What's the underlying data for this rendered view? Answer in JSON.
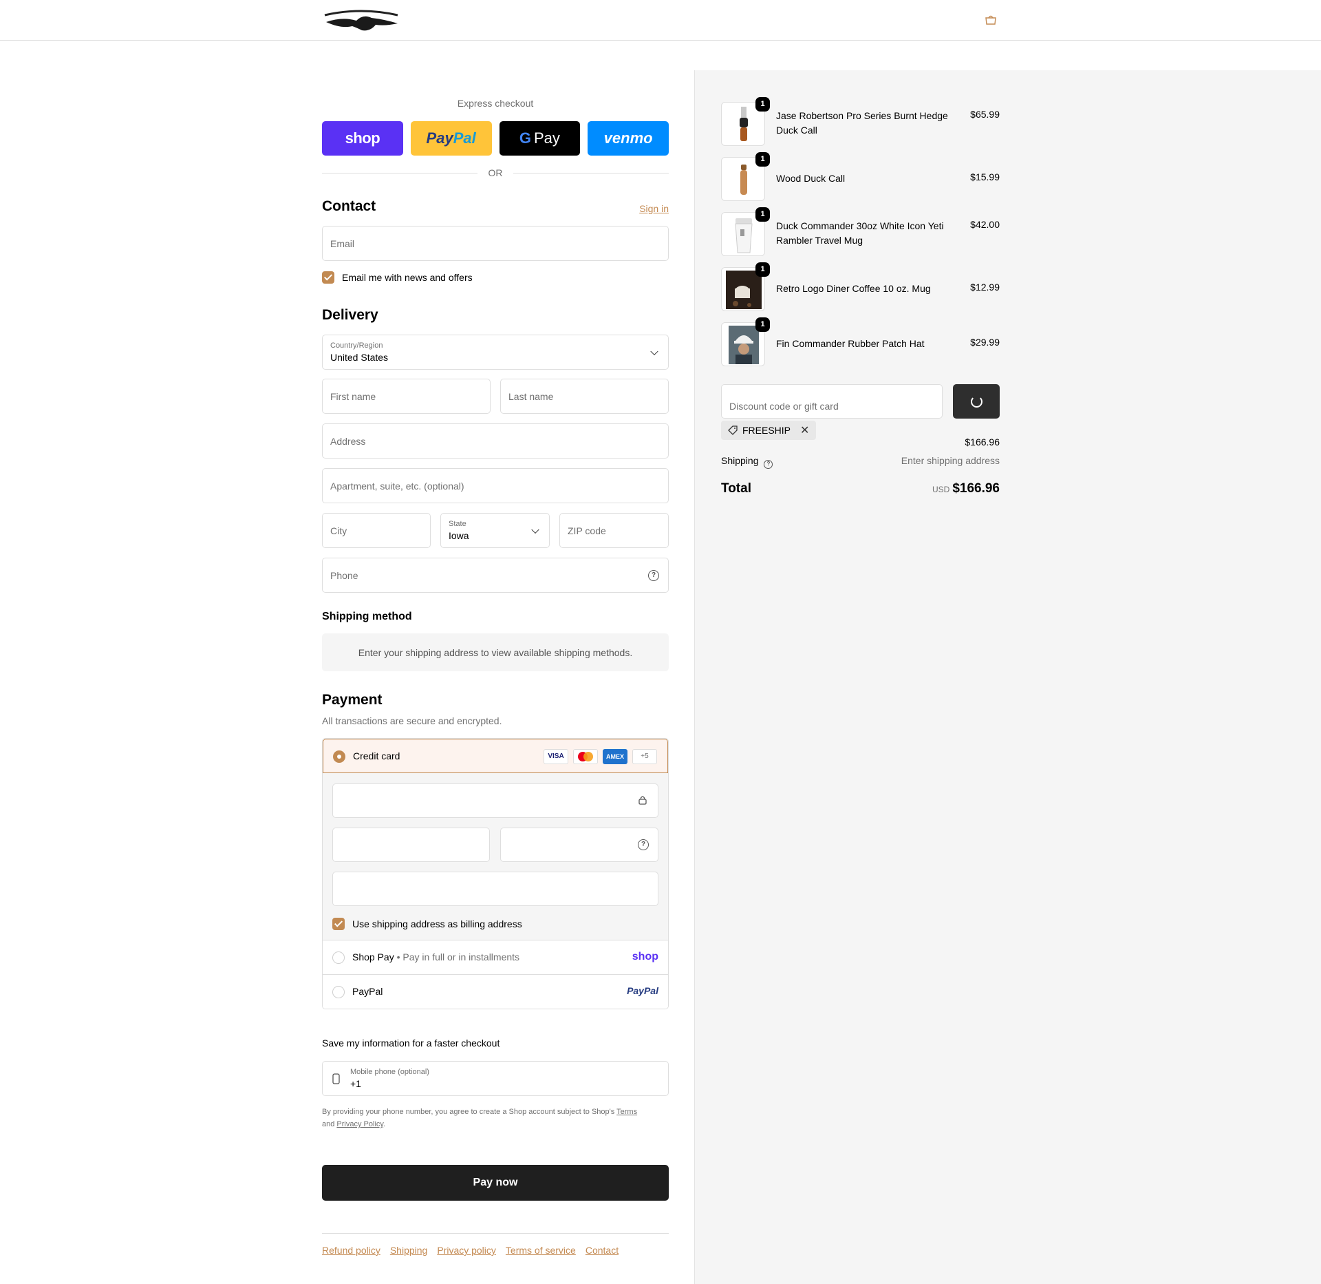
{
  "header": {
    "logo_name": "duck-commander-logo",
    "cart_icon": "bag-icon"
  },
  "express": {
    "title": "Express checkout",
    "buttons": [
      "shop",
      "PayPal",
      "Pay",
      "venmo"
    ],
    "or": "OR"
  },
  "contact": {
    "heading": "Contact",
    "sign_in": "Sign in",
    "email_placeholder": "Email",
    "news_label": "Email me with news and offers"
  },
  "delivery": {
    "heading": "Delivery",
    "country_label": "Country/Region",
    "country_value": "United States",
    "first_name": "First name",
    "last_name": "Last name",
    "address": "Address",
    "apartment": "Apartment, suite, etc. (optional)",
    "city": "City",
    "state_label": "State",
    "state_value": "Iowa",
    "zip": "ZIP code",
    "phone": "Phone"
  },
  "shipping_method": {
    "heading": "Shipping method",
    "notice": "Enter your shipping address to view available shipping methods."
  },
  "payment": {
    "heading": "Payment",
    "subtitle": "All transactions are secure and encrypted.",
    "credit_card": "Credit card",
    "card_logos": [
      "VISA",
      "MC",
      "AMEX",
      "+5"
    ],
    "billing_label": "Use shipping address as billing address",
    "shop_pay": "Shop Pay",
    "shop_pay_sub": "Pay in full or in installments",
    "shop_brand": "shop",
    "paypal": "PayPal",
    "paypal_brand": "PayPal"
  },
  "save_info": {
    "heading": "Save my information for a faster checkout",
    "mobile_label": "Mobile phone (optional)",
    "mobile_value": "+1",
    "terms_pre": "By providing your phone number, you agree to create a Shop account subject to Shop's ",
    "terms_link": "Terms",
    "terms_mid": " and ",
    "privacy_link": "Privacy Policy",
    "terms_end": "."
  },
  "pay_now": "Pay now",
  "footer": {
    "links": [
      "Refund policy",
      "Shipping",
      "Privacy policy",
      "Terms of service",
      "Contact"
    ]
  },
  "summary": {
    "items": [
      {
        "name": "Jase Robertson Pro Series Burnt Hedge Duck Call",
        "price": "$65.99",
        "qty": "1"
      },
      {
        "name": "Wood Duck Call",
        "price": "$15.99",
        "qty": "1"
      },
      {
        "name": "Duck Commander 30oz White Icon Yeti Rambler Travel Mug",
        "price": "$42.00",
        "qty": "1"
      },
      {
        "name": "Retro Logo Diner Coffee 10 oz. Mug",
        "price": "$12.99",
        "qty": "1"
      },
      {
        "name": "Fin Commander Rubber Patch Hat",
        "price": "$29.99",
        "qty": "1"
      }
    ],
    "discount_placeholder": "Discount code or gift card",
    "discount_tag": "FREESHIP",
    "subtotal": "$166.96",
    "shipping_label": "Shipping",
    "shipping_value": "Enter shipping address",
    "total_label": "Total",
    "currency": "USD",
    "total": "$166.96"
  }
}
